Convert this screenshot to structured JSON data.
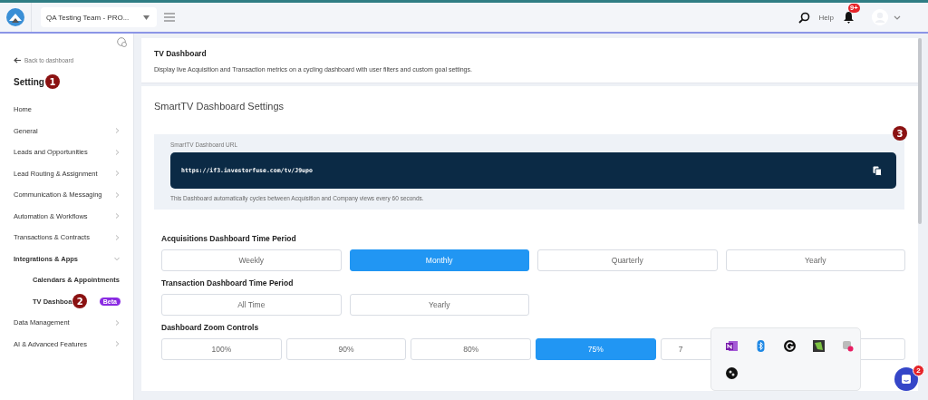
{
  "topbar": {
    "team": "QA Testing Team - PRO...",
    "help": "Help",
    "notification_count": "9+"
  },
  "sidebar": {
    "back": "Back to dashboard",
    "title": "Setting",
    "title_marker": "1",
    "items": [
      {
        "label": "Home",
        "kind": "link"
      },
      {
        "label": "General",
        "kind": "group",
        "expanded": false
      },
      {
        "label": "Leads and Opportunities",
        "kind": "group",
        "expanded": false
      },
      {
        "label": "Lead Routing & Assignment",
        "kind": "group",
        "expanded": false
      },
      {
        "label": "Communication & Messaging",
        "kind": "group",
        "expanded": false
      },
      {
        "label": "Automation & Workflows",
        "kind": "group",
        "expanded": false
      },
      {
        "label": "Transactions & Contracts",
        "kind": "group",
        "expanded": false
      },
      {
        "label": "Integrations & Apps",
        "kind": "group",
        "expanded": true,
        "children": [
          {
            "label": "Calendars & Appointments"
          },
          {
            "label": "TV Dashboa",
            "marker": "2",
            "badge": "Beta"
          }
        ]
      },
      {
        "label": "Data Management",
        "kind": "group",
        "expanded": false
      },
      {
        "label": "AI & Advanced Features",
        "kind": "group",
        "expanded": false
      }
    ]
  },
  "page": {
    "title": "TV Dashboard",
    "description": "Display live Acquisition and Transaction metrics on a cycling dashboard with user filters and custom goal settings."
  },
  "settings": {
    "title": "SmartTV Dashboard Settings",
    "url_label": "SmartTV Dashboard URL",
    "url": "https://if3.investorfuse.com/tv/J9upo",
    "marker": "3",
    "note": "This Dashboard automatically cycles between Acquisition and Company views every 60 seconds.",
    "groups": [
      {
        "title": "Acquisitions Dashboard Time Period",
        "options": [
          {
            "label": "Weekly",
            "selected": false
          },
          {
            "label": "Monthly",
            "selected": true
          },
          {
            "label": "Quarterly",
            "selected": false
          },
          {
            "label": "Yearly",
            "selected": false
          }
        ]
      },
      {
        "title": "Transaction Dashboard Time Period",
        "options": [
          {
            "label": "All Time",
            "selected": false
          },
          {
            "label": "Yearly",
            "selected": false
          }
        ]
      },
      {
        "title": "Dashboard Zoom Controls",
        "options": [
          {
            "label": "100%",
            "selected": false
          },
          {
            "label": "90%",
            "selected": false
          },
          {
            "label": "80%",
            "selected": false
          },
          {
            "label": "75%",
            "selected": true
          },
          {
            "label": "7",
            "selected": false,
            "kind": "covered"
          },
          {
            "selected": false
          }
        ]
      }
    ]
  },
  "chat": {
    "badge": "2"
  }
}
